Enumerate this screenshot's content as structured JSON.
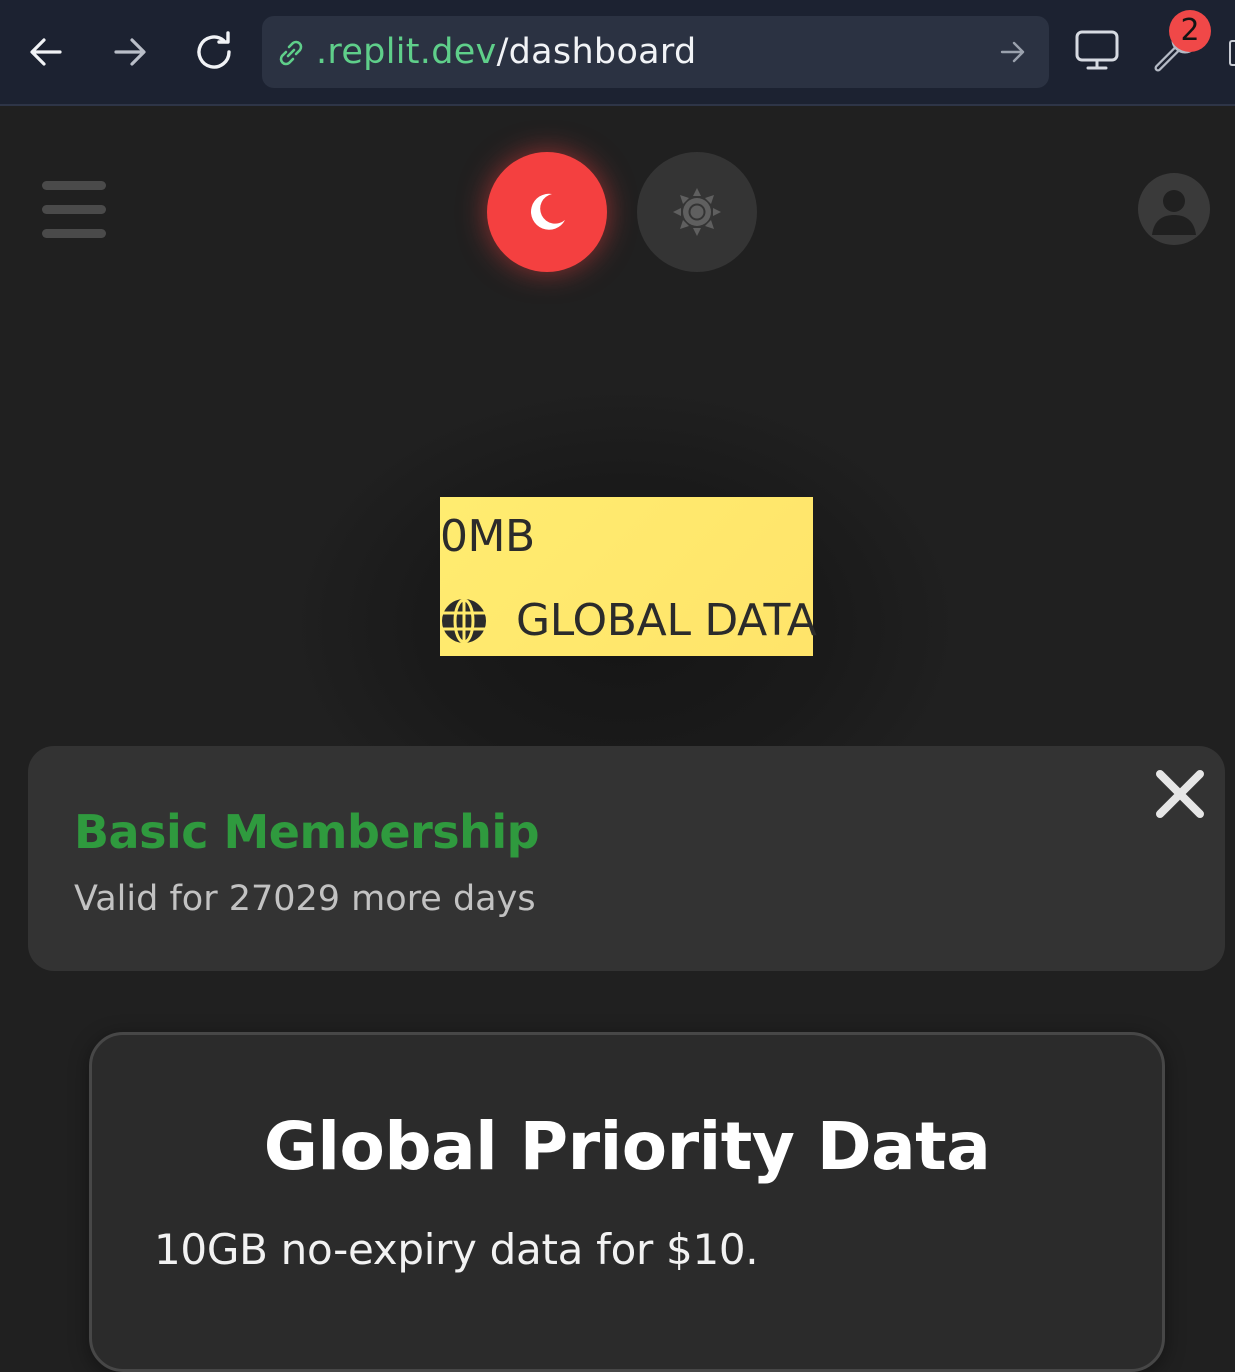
{
  "browser": {
    "url_host": ".replit.dev",
    "url_path": "/dashboard",
    "extension_badge_count": "2"
  },
  "header": {
    "theme_dark_icon": "moon-icon",
    "theme_light_icon": "sun-icon",
    "menu_icon": "hamburger-menu-icon",
    "profile_icon": "user-avatar-icon"
  },
  "data_usage": {
    "amount": "0MB",
    "label": "GLOBAL DATA",
    "icon": "globe-icon"
  },
  "membership": {
    "title": "Basic Membership",
    "validity": "Valid for 27029 more days"
  },
  "offer": {
    "title": "Global Priority Data",
    "description": "10GB no-expiry data for $10."
  },
  "colors": {
    "accent_red": "#f44040",
    "membership_green": "#2f9a3e",
    "data_box_yellow": "#ffe96e",
    "background": "#202020"
  }
}
